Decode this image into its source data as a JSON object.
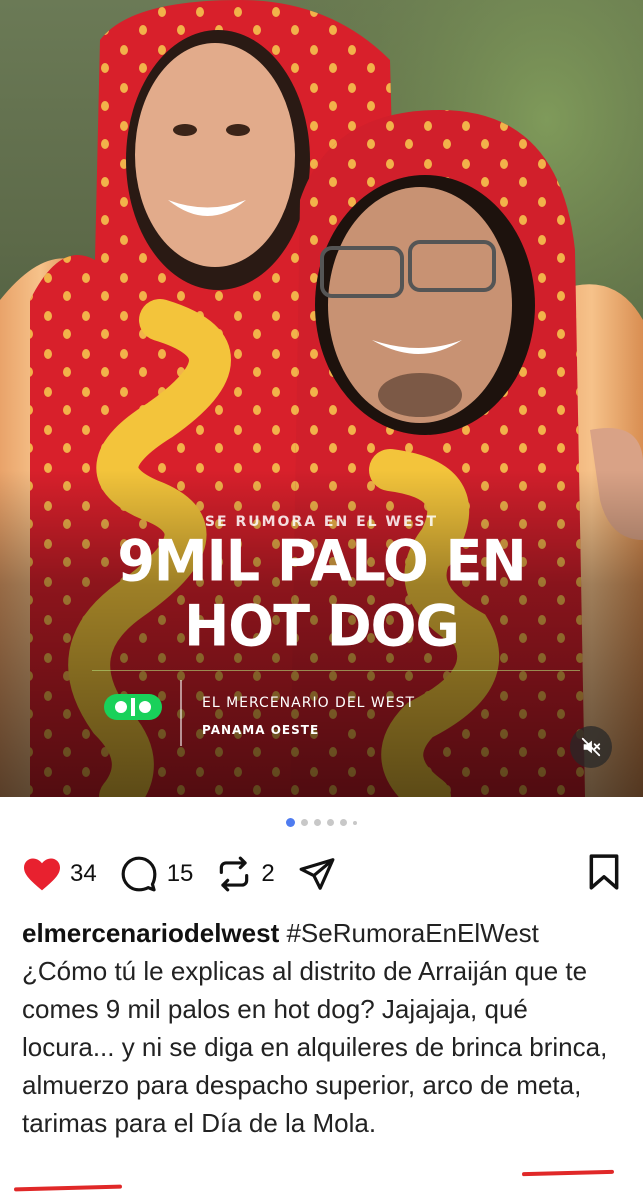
{
  "post": {
    "kicker": "SE RUMORA EN EL WEST",
    "headline_line1": "9MIL PALO EN",
    "headline_line2": "HOT DOG",
    "brand_name": "EL MERCENARIO DEL WEST",
    "brand_region": "PANAMA OESTE",
    "brand_color": "#19d15a",
    "mute_icon": "speaker-muted-icon"
  },
  "carousel": {
    "active_index": 0,
    "total_dots": 6
  },
  "actions": {
    "likes": "34",
    "comments": "15",
    "reposts": "2",
    "like_color": "#e8212f"
  },
  "caption": {
    "username": "elmercenariodelwest",
    "hashtag": "#SeRumoraEnElWest",
    "text_main": "¿Cómo tú le explicas al distrito de Arraiján que te comes 9 mil palos en hot dog? Jajajaja, qué locura... y ni se diga en alquileres de brinca brinca, almuerzo para despacho superior, arco de meta, tarimas para el ",
    "text_highlight": "Día de la Mola",
    "text_end": ".",
    "underline_color": "#e02828"
  }
}
